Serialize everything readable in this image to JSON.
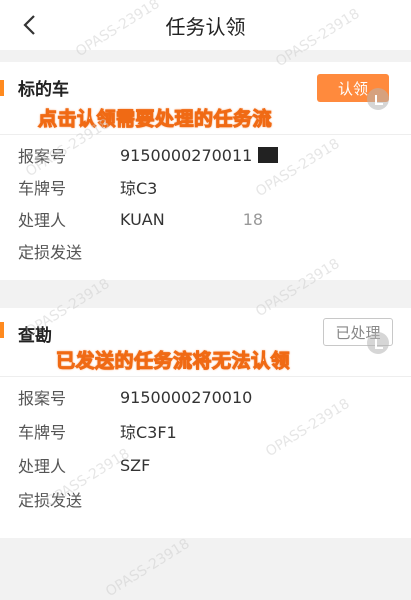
{
  "header": {
    "title": "任务认领"
  },
  "card1": {
    "name": "标的车",
    "claim_label": "认领",
    "annotation": "点击认领需要处理的任务流",
    "rows": [
      {
        "label": "报案号",
        "value": "9150000270011"
      },
      {
        "label": "车牌号",
        "value": "琼C3"
      },
      {
        "label": "处理人",
        "value": "KUAN"
      },
      {
        "label": "定损发送",
        "value": ""
      }
    ],
    "trailing_digits": "18"
  },
  "card2": {
    "name": "查勘",
    "handled_label": "已处理",
    "annotation": "已发送的任务流将无法认领",
    "rows": [
      {
        "label": "报案号",
        "value": "9150000270010"
      },
      {
        "label": "车牌号",
        "value": "琼C3F1"
      },
      {
        "label": "处理人",
        "value": "SZF"
      },
      {
        "label": "定损发送",
        "value": ""
      }
    ]
  },
  "watermark": "OPASS-23918",
  "colors": {
    "accent": "#ff8a3d",
    "background": "#f2f2f2"
  },
  "icons": {
    "back": "chevron-left-icon",
    "pointer": "hand-pointer-icon"
  }
}
